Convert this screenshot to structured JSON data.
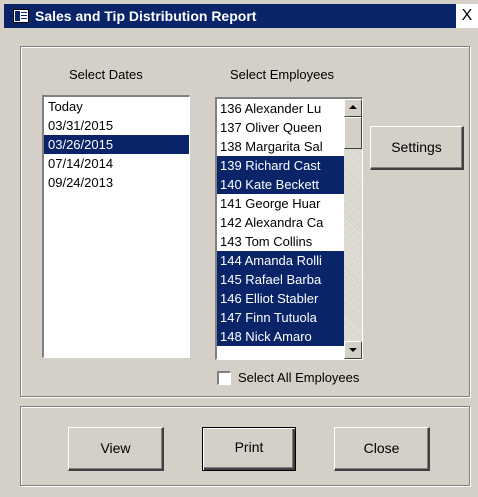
{
  "window": {
    "title": "Sales and Tip Distribution Report",
    "close_glyph": "X"
  },
  "dates": {
    "label": "Select Dates",
    "items": [
      {
        "text": "Today",
        "selected": false
      },
      {
        "text": "03/31/2015",
        "selected": false
      },
      {
        "text": "03/26/2015",
        "selected": true
      },
      {
        "text": "07/14/2014",
        "selected": false
      },
      {
        "text": "09/24/2013",
        "selected": false
      }
    ]
  },
  "employees": {
    "label": "Select Employees",
    "items": [
      {
        "text": "136 Alexander Lu",
        "selected": false
      },
      {
        "text": "137 Oliver Queen",
        "selected": false
      },
      {
        "text": "138 Margarita Sal",
        "selected": false
      },
      {
        "text": "139 Richard Cast",
        "selected": true
      },
      {
        "text": "140 Kate Beckett",
        "selected": true
      },
      {
        "text": "141 George Huar",
        "selected": false
      },
      {
        "text": "142 Alexandra Ca",
        "selected": false
      },
      {
        "text": "143 Tom Collins",
        "selected": false
      },
      {
        "text": "144 Amanda Rolli",
        "selected": true
      },
      {
        "text": "145 Rafael Barba",
        "selected": true
      },
      {
        "text": "146 Elliot Stabler",
        "selected": true
      },
      {
        "text": "147 Finn Tutuola",
        "selected": true
      },
      {
        "text": "148 Nick Amaro",
        "selected": true
      }
    ],
    "select_all_label": "Select All Employees",
    "select_all_checked": false
  },
  "buttons": {
    "settings": "Settings",
    "view": "View",
    "print": "Print",
    "close": "Close"
  },
  "colors": {
    "selection": "#0a246a",
    "face": "#d4d0c8"
  }
}
